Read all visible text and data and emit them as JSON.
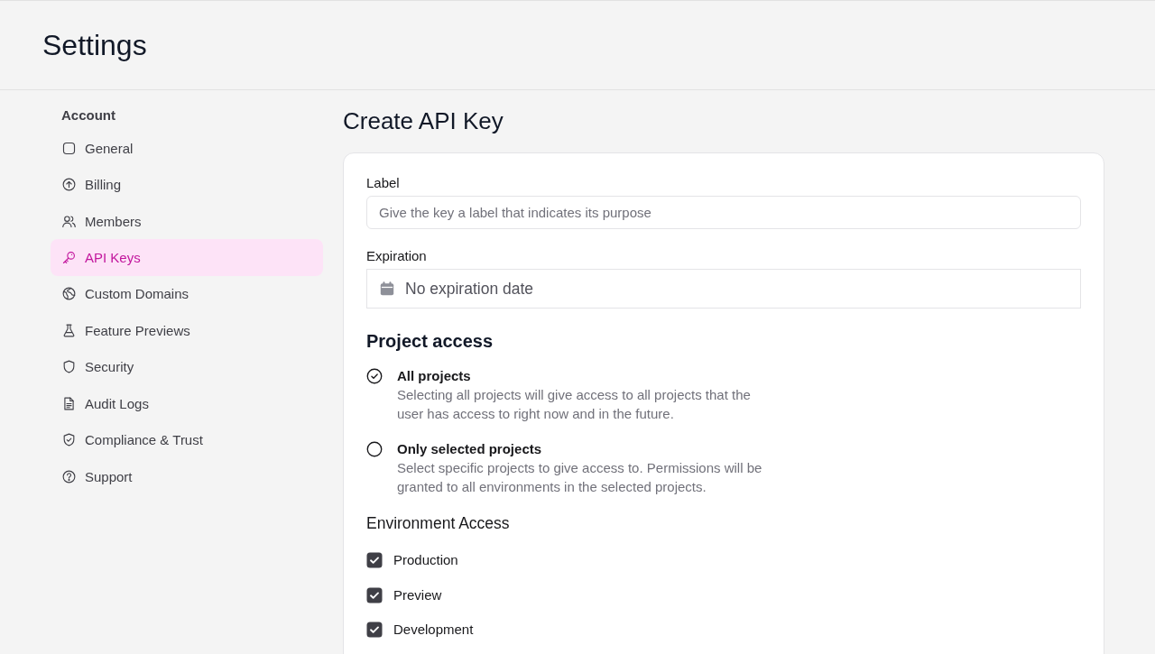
{
  "header": {
    "title": "Settings"
  },
  "sidebar": {
    "heading": "Account",
    "items": [
      {
        "label": "General",
        "selected": false
      },
      {
        "label": "Billing",
        "selected": false
      },
      {
        "label": "Members",
        "selected": false
      },
      {
        "label": "API Keys",
        "selected": true
      },
      {
        "label": "Custom Domains",
        "selected": false
      },
      {
        "label": "Feature Previews",
        "selected": false
      },
      {
        "label": "Security",
        "selected": false
      },
      {
        "label": "Audit Logs",
        "selected": false
      },
      {
        "label": "Compliance & Trust",
        "selected": false
      },
      {
        "label": "Support",
        "selected": false
      }
    ]
  },
  "page_title": "Create API Key",
  "form": {
    "label": {
      "label": "Label",
      "placeholder": "Give the key a label that indicates its purpose"
    },
    "expiration": {
      "label": "Expiration",
      "value": "No expiration date"
    },
    "project_access": {
      "heading": "Project access",
      "options": [
        {
          "label": "All projects",
          "description": "Selecting all projects will give access to all projects that the user has access to right now and in the future.",
          "selected": true
        },
        {
          "label": "Only selected projects",
          "description": "Select specific projects to give access to. Permissions will be granted to all environments in the selected projects.",
          "selected": false
        }
      ]
    },
    "environment_access": {
      "heading": "Environment Access",
      "items": [
        {
          "label": "Production",
          "checked": true
        },
        {
          "label": "Preview",
          "checked": true
        },
        {
          "label": "Development",
          "checked": true
        }
      ]
    }
  }
}
